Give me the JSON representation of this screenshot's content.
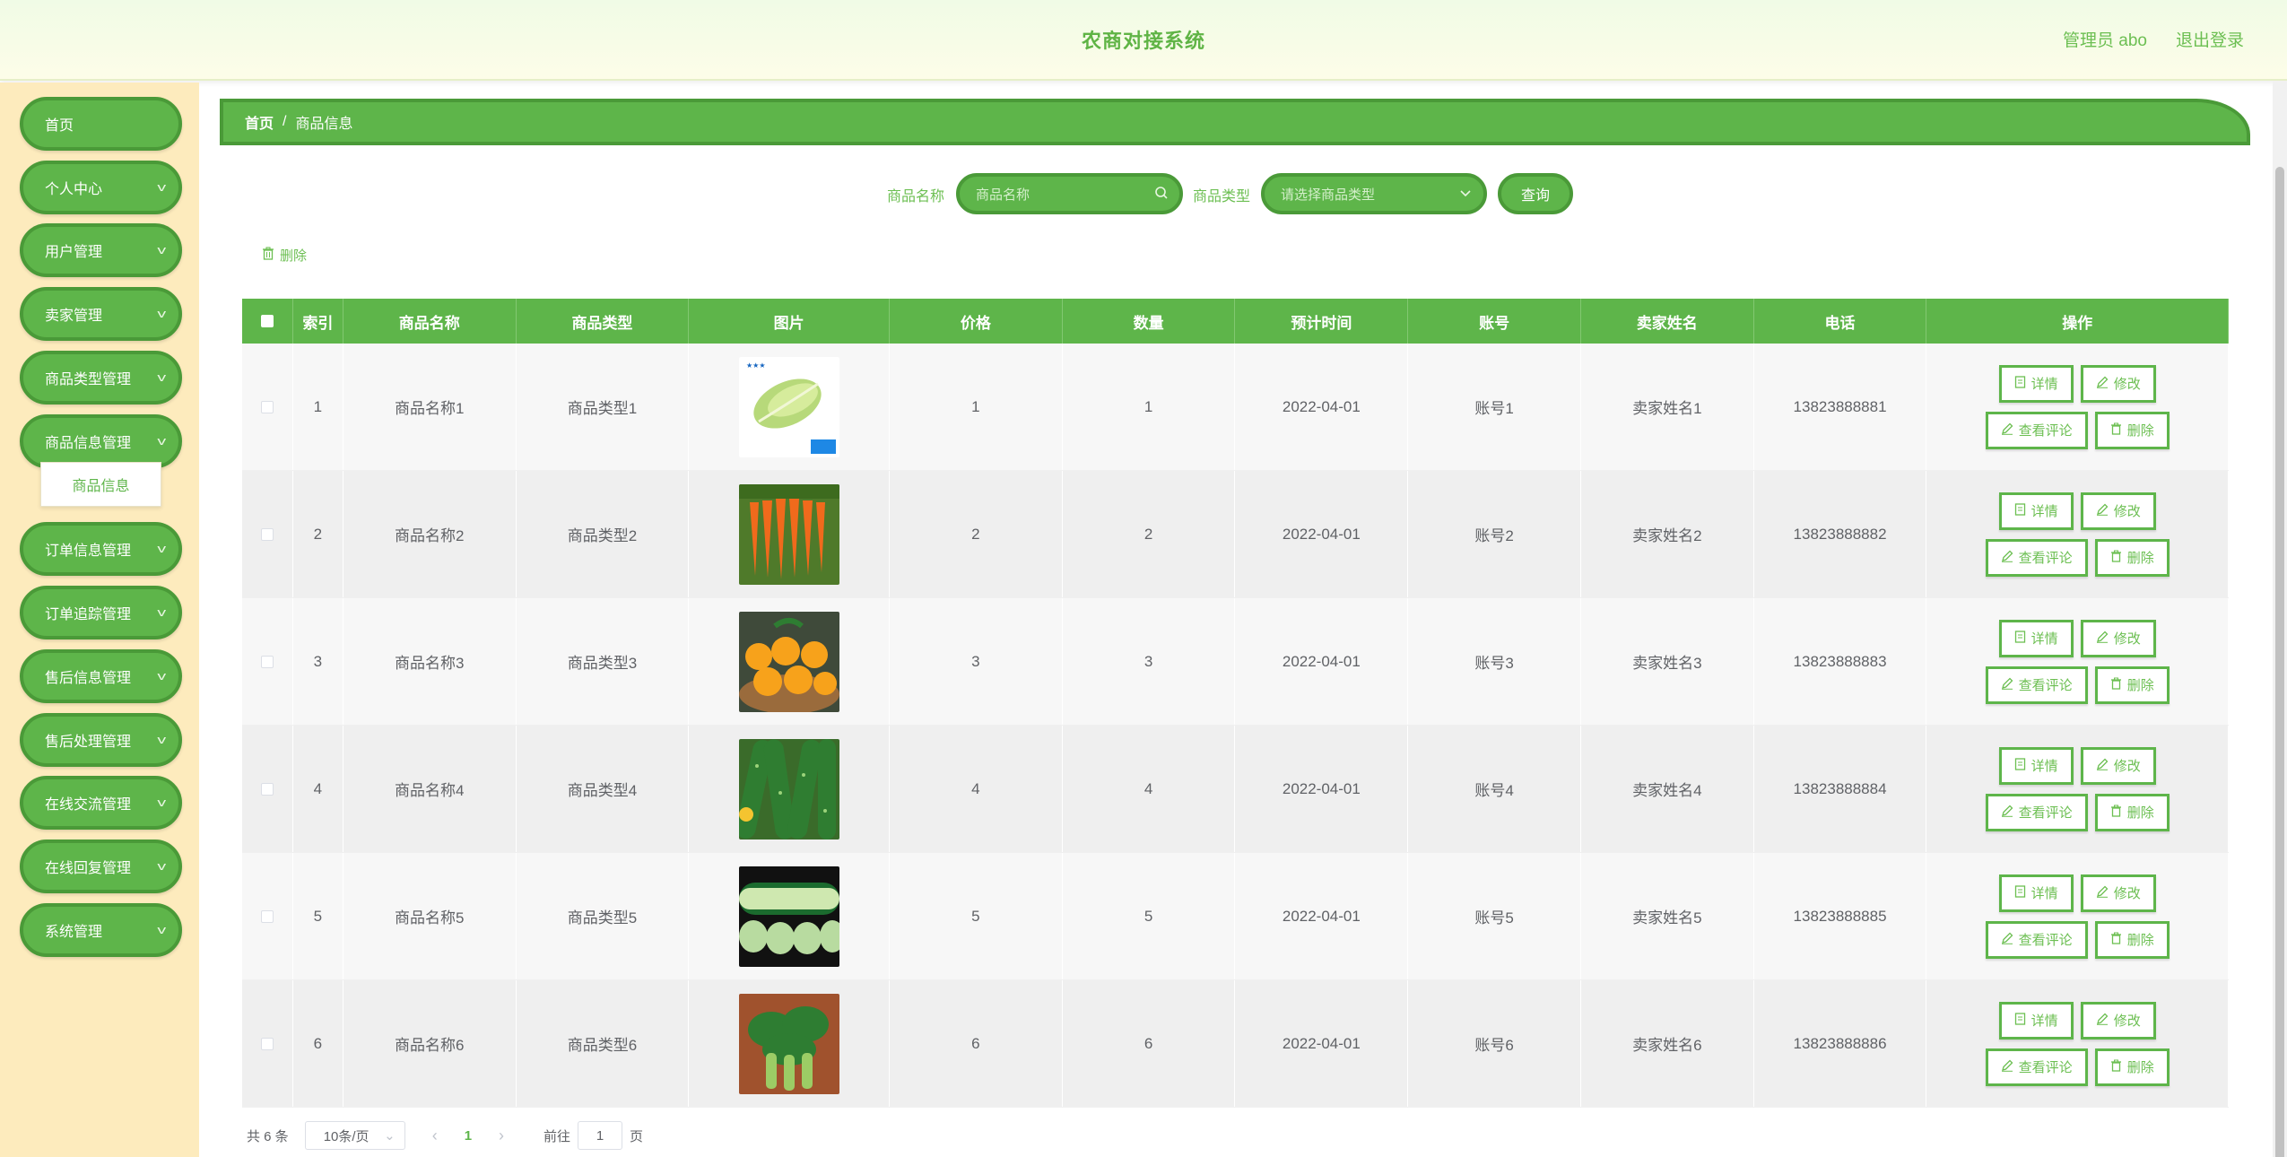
{
  "header": {
    "title": "农商对接系统",
    "user_label": "管理员 abo",
    "logout_label": "退出登录"
  },
  "sidebar": {
    "items": [
      {
        "label": "首页",
        "has_children": false
      },
      {
        "label": "个人中心",
        "has_children": true
      },
      {
        "label": "用户管理",
        "has_children": true
      },
      {
        "label": "卖家管理",
        "has_children": true
      },
      {
        "label": "商品类型管理",
        "has_children": true
      },
      {
        "label": "商品信息管理",
        "has_children": true
      },
      {
        "label": "订单信息管理",
        "has_children": true
      },
      {
        "label": "订单追踪管理",
        "has_children": true
      },
      {
        "label": "售后信息管理",
        "has_children": true
      },
      {
        "label": "售后处理管理",
        "has_children": true
      },
      {
        "label": "在线交流管理",
        "has_children": true
      },
      {
        "label": "在线回复管理",
        "has_children": true
      },
      {
        "label": "系统管理",
        "has_children": true
      }
    ],
    "submenu_active": "商品信息"
  },
  "breadcrumb": {
    "home": "首页",
    "separator": "/",
    "current": "商品信息"
  },
  "search": {
    "name_label": "商品名称",
    "name_placeholder": "商品名称",
    "type_label": "商品类型",
    "type_placeholder": "请选择商品类型",
    "query_label": "查询"
  },
  "toolbar": {
    "delete_label": "删除"
  },
  "table": {
    "columns": [
      "索引",
      "商品名称",
      "商品类型",
      "图片",
      "价格",
      "数量",
      "预计时间",
      "账号",
      "卖家姓名",
      "电话",
      "操作"
    ],
    "rows": [
      {
        "index": "1",
        "name": "商品名称1",
        "type": "商品类型1",
        "image": "lettuce",
        "price": "1",
        "qty": "1",
        "time": "2022-04-01",
        "account": "账号1",
        "seller": "卖家姓名1",
        "phone": "13823888881"
      },
      {
        "index": "2",
        "name": "商品名称2",
        "type": "商品类型2",
        "image": "carrots",
        "price": "2",
        "qty": "2",
        "time": "2022-04-01",
        "account": "账号2",
        "seller": "卖家姓名2",
        "phone": "13823888882"
      },
      {
        "index": "3",
        "name": "商品名称3",
        "type": "商品类型3",
        "image": "oranges",
        "price": "3",
        "qty": "3",
        "time": "2022-04-01",
        "account": "账号3",
        "seller": "卖家姓名3",
        "phone": "13823888883"
      },
      {
        "index": "4",
        "name": "商品名称4",
        "type": "商品类型4",
        "image": "cucumbers",
        "price": "4",
        "qty": "4",
        "time": "2022-04-01",
        "account": "账号4",
        "seller": "卖家姓名4",
        "phone": "13823888884"
      },
      {
        "index": "5",
        "name": "商品名称5",
        "type": "商品类型5",
        "image": "radish",
        "price": "5",
        "qty": "5",
        "time": "2022-04-01",
        "account": "账号5",
        "seller": "卖家姓名5",
        "phone": "13823888885"
      },
      {
        "index": "6",
        "name": "商品名称6",
        "type": "商品类型6",
        "image": "greens",
        "price": "6",
        "qty": "6",
        "time": "2022-04-01",
        "account": "账号6",
        "seller": "卖家姓名6",
        "phone": "13823888886"
      }
    ],
    "actions": {
      "detail": "详情",
      "edit": "修改",
      "comments": "查看评论",
      "delete": "删除"
    }
  },
  "pagination": {
    "total": "共 6 条",
    "page_size": "10条/页",
    "current": "1",
    "goto_label": "前往",
    "goto_value": "1",
    "page_suffix": "页"
  },
  "colors": {
    "accent": "#5eb54a",
    "accent_dark": "#4a9a38",
    "sidebar_bg": "#fdebbd"
  }
}
